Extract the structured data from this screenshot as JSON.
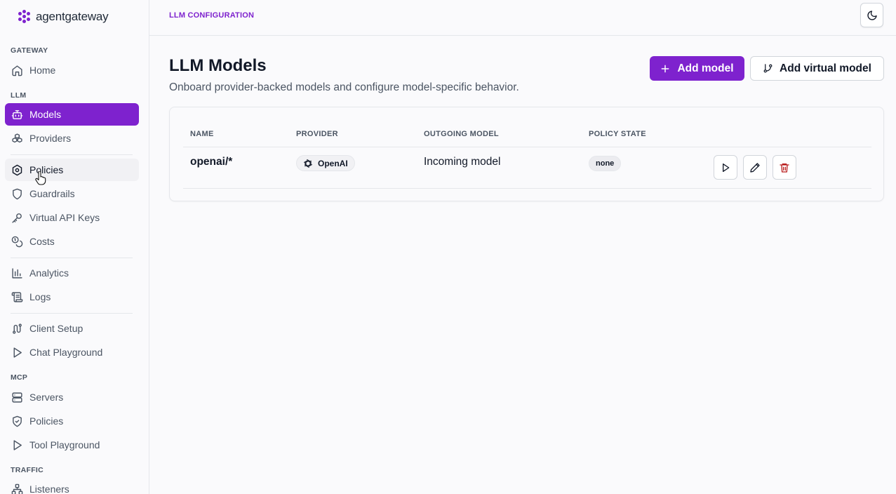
{
  "brand": {
    "name": "agentgateway",
    "accent": "#7e22ce"
  },
  "sidebar": {
    "sections": {
      "gateway": "GATEWAY",
      "llm": "LLM",
      "mcp": "MCP",
      "traffic": "TRAFFIC"
    },
    "items": {
      "home": {
        "label": "Home",
        "icon": "home-icon"
      },
      "models": {
        "label": "Models",
        "icon": "bot-icon",
        "active": true
      },
      "providers": {
        "label": "Providers",
        "icon": "boxes-icon"
      },
      "policies": {
        "label": "Policies",
        "icon": "gear-hexagon-icon",
        "hovered": true
      },
      "guardrails": {
        "label": "Guardrails",
        "icon": "shield-icon"
      },
      "virtual_api_keys": {
        "label": "Virtual API Keys",
        "icon": "key-icon"
      },
      "costs": {
        "label": "Costs",
        "icon": "coins-icon"
      },
      "analytics": {
        "label": "Analytics",
        "icon": "bar-chart-icon"
      },
      "logs": {
        "label": "Logs",
        "icon": "scroll-icon"
      },
      "client_setup": {
        "label": "Client Setup",
        "icon": "route-icon"
      },
      "chat_playground": {
        "label": "Chat Playground",
        "icon": "play-icon"
      },
      "servers": {
        "label": "Servers",
        "icon": "server-icon"
      },
      "mcp_policies": {
        "label": "Policies",
        "icon": "shield-check-icon"
      },
      "tool_playground": {
        "label": "Tool Playground",
        "icon": "play-icon"
      },
      "listeners": {
        "label": "Listeners",
        "icon": "network-icon"
      }
    }
  },
  "topbar": {
    "section_label": "LLM CONFIGURATION",
    "theme_toggle_icon": "moon-icon"
  },
  "page": {
    "title": "LLM Models",
    "subtitle": "Onboard provider-backed models and configure model-specific behavior.",
    "add_model_label": "Add model",
    "add_virtual_model_label": "Add virtual model"
  },
  "table": {
    "columns": {
      "name": "NAME",
      "provider": "PROVIDER",
      "outgoing_model": "OUTGOING MODEL",
      "policy_state": "POLICY STATE"
    },
    "rows": [
      {
        "name": "openai/*",
        "provider": "OpenAI",
        "outgoing_model": "Incoming model",
        "policy_state": "none"
      }
    ]
  }
}
